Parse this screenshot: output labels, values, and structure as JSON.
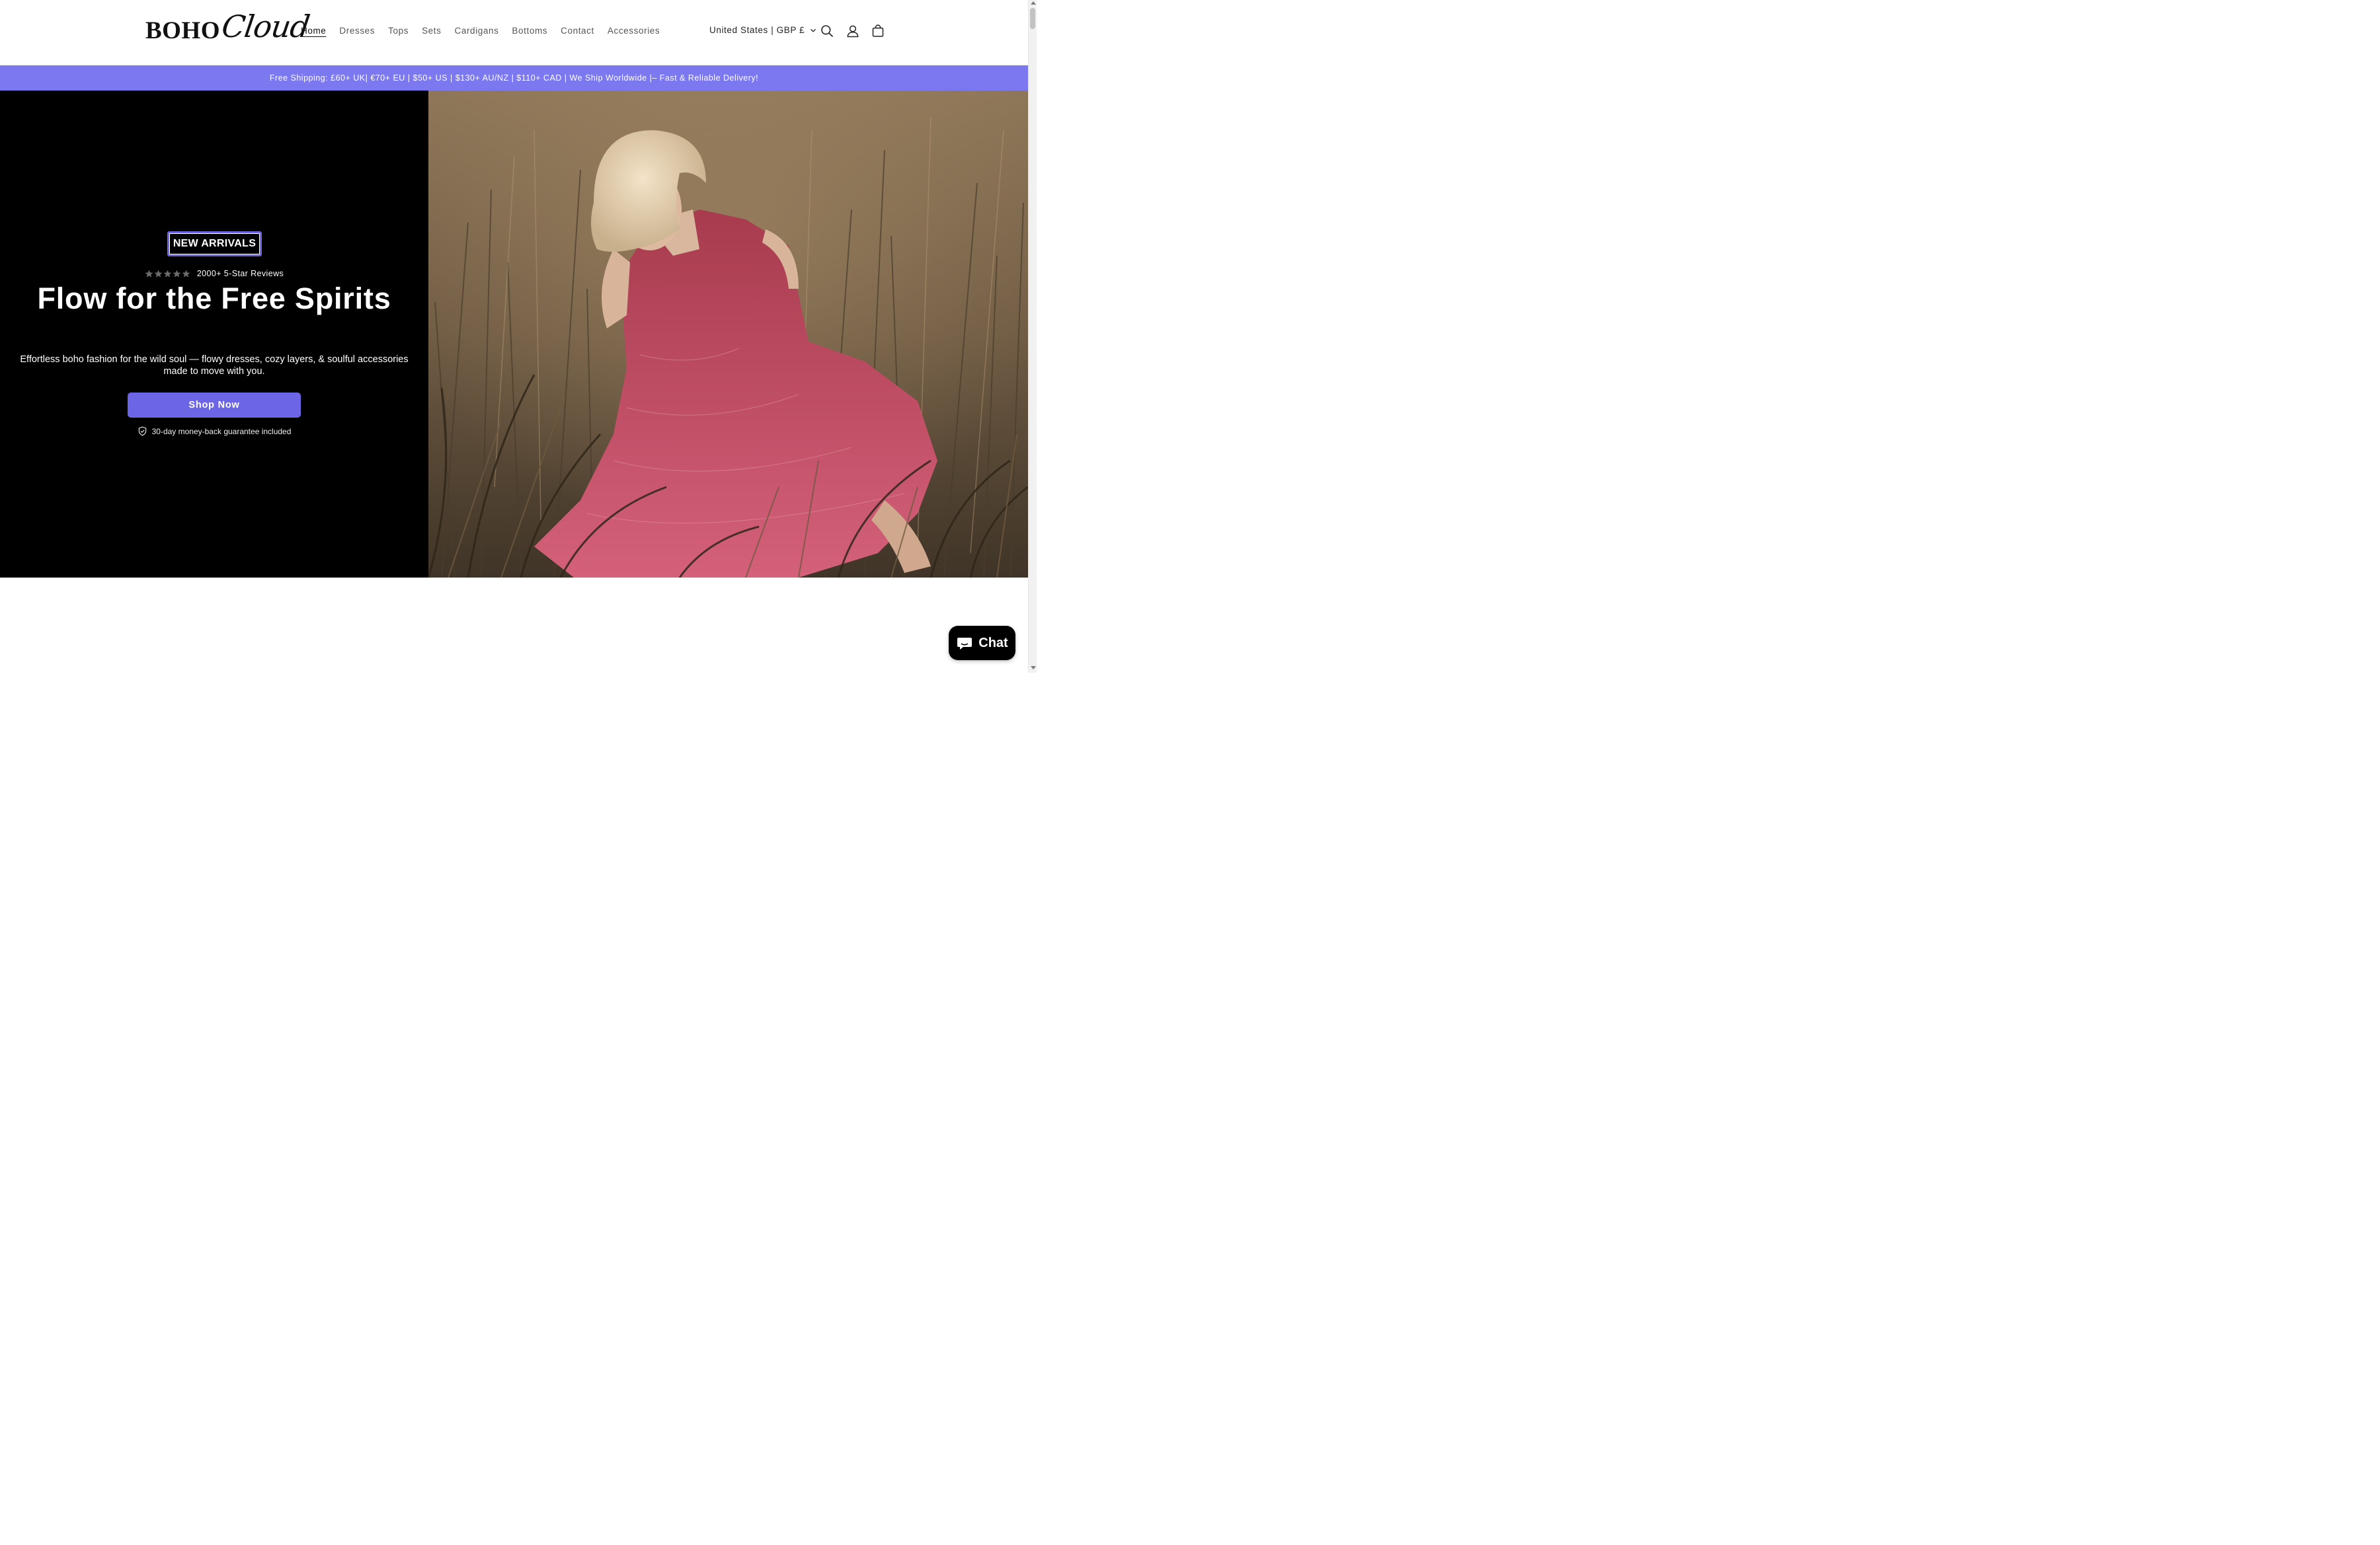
{
  "brand": {
    "logo_part1": "BOHO",
    "logo_part2": "Cloud"
  },
  "nav": {
    "items": [
      {
        "label": "Home",
        "active": true
      },
      {
        "label": "Dresses"
      },
      {
        "label": "Tops"
      },
      {
        "label": "Sets"
      },
      {
        "label": "Cardigans"
      },
      {
        "label": "Bottoms"
      },
      {
        "label": "Contact"
      },
      {
        "label": "Accessories"
      }
    ]
  },
  "header": {
    "locale_label": "United States | GBP £",
    "icons": [
      "search-icon",
      "account-icon",
      "cart-icon"
    ]
  },
  "announcement": {
    "text": "Free Shipping: £60+ UK| €70+ EU | $50+ US | $130+ AU/NZ | $110+ CAD | We Ship Worldwide |– Fast & Reliable Delivery!",
    "bg_color": "#7b78f0"
  },
  "hero": {
    "badge": "NEW ARRIVALS",
    "rating_stars": 5,
    "reviews_text": "2000+ 5-Star Reviews",
    "headline": "Flow for the Free Spirits",
    "subtext": "Effortless boho fashion for the wild soul — flowy dresses, cozy layers, & soulful accessories made to move with you.",
    "cta_label": "Shop Now",
    "guarantee_text": "30-day money-back guarantee included",
    "accent_color": "#6c66e6"
  },
  "chat": {
    "label": "Chat"
  }
}
